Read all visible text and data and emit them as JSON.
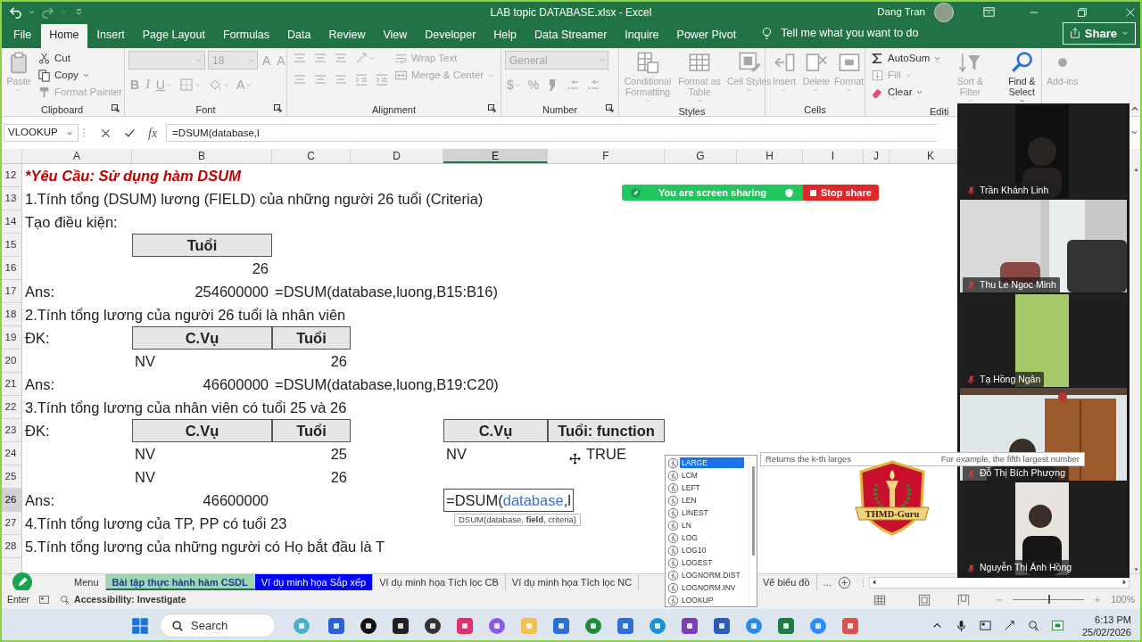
{
  "window": {
    "title": "LAB topic DATABASE.xlsx  -  Excel",
    "user": "Dang Tran"
  },
  "ribbon_tabs": [
    {
      "label": "File",
      "selected": false
    },
    {
      "label": "Home",
      "selected": true
    },
    {
      "label": "Insert",
      "selected": false
    },
    {
      "label": "Page Layout",
      "selected": false
    },
    {
      "label": "Formulas",
      "selected": false
    },
    {
      "label": "Data",
      "selected": false
    },
    {
      "label": "Review",
      "selected": false
    },
    {
      "label": "View",
      "selected": false
    },
    {
      "label": "Developer",
      "selected": false
    },
    {
      "label": "Help",
      "selected": false
    },
    {
      "label": "Data Streamer",
      "selected": false
    },
    {
      "label": "Inquire",
      "selected": false
    },
    {
      "label": "Power Pivot",
      "selected": false
    }
  ],
  "tell_me": {
    "placeholder": "Tell me what you want to do"
  },
  "share_button": "Share",
  "ribbon_groups": [
    {
      "label": "Clipboard",
      "items": [
        {
          "kind": "large",
          "label": "Paste",
          "disabled": true,
          "dropdown": true
        },
        {
          "kind": "stack",
          "buttons": [
            {
              "kind": "text",
              "label": "Cut",
              "disabled": false,
              "dropdown": false
            },
            {
              "kind": "text",
              "label": "Copy",
              "disabled": false,
              "dropdown": true
            },
            {
              "kind": "text",
              "label": "Format Painter",
              "disabled": true,
              "dropdown": false
            }
          ]
        },
        {
          "kind": "launcher"
        }
      ]
    },
    {
      "label": "Font",
      "items": [
        {
          "kind": "rows",
          "rows": [
            [
              {
                "kind": "combo",
                "disabled": true
              },
              {
                "kind": "combo",
                "value": "18",
                "disabled": true
              },
              {
                "kind": "glyph",
                "label": "A",
                "disabled": true,
                "dropdown": false
              },
              {
                "kind": "glyph",
                "label": "A",
                "disabled": true,
                "dropdown": false
              }
            ],
            [
              {
                "kind": "glyph",
                "label": "B",
                "disabled": true,
                "dropdown": false
              },
              {
                "kind": "glyph",
                "label": "I",
                "disabled": true,
                "dropdown": false
              },
              {
                "kind": "glyph",
                "label": "U",
                "disabled": true,
                "dropdown": true
              },
              {
                "kind": "icon",
                "disabled": true,
                "dropdown": true
              },
              {
                "kind": "icon",
                "disabled": true,
                "dropdown": true
              },
              {
                "kind": "glyph",
                "label": "A",
                "disabled": true,
                "dropdown": true
              }
            ]
          ]
        },
        {
          "kind": "launcher"
        }
      ]
    },
    {
      "label": "Alignment",
      "items": [
        {
          "kind": "rows",
          "rows": [
            [
              {
                "kind": "icon",
                "disabled": true,
                "dropdown": false
              },
              {
                "kind": "icon",
                "disabled": true,
                "dropdown": false
              },
              {
                "kind": "icon",
                "disabled": true,
                "dropdown": false
              },
              {
                "kind": "icon",
                "disabled": true,
                "dropdown": true
              }
            ],
            [
              {
                "kind": "icon",
                "disabled": true,
                "dropdown": false
              },
              {
                "kind": "icon",
                "disabled": true,
                "dropdown": false
              },
              {
                "kind": "icon",
                "disabled": true,
                "dropdown": false
              },
              {
                "kind": "icon",
                "disabled": true,
                "dropdown": false
              },
              {
                "kind": "icon",
                "disabled": true,
                "dropdown": false
              }
            ]
          ]
        },
        {
          "kind": "stack",
          "buttons": [
            {
              "kind": "text",
              "label": "Wrap Text",
              "disabled": true,
              "dropdown": false
            },
            {
              "kind": "text",
              "label": "Merge & Center",
              "disabled": true,
              "dropdown": true
            }
          ]
        },
        {
          "kind": "launcher"
        }
      ]
    },
    {
      "label": "Number",
      "items": [
        {
          "kind": "rows",
          "rows": [
            [
              {
                "kind": "combo",
                "value": "General",
                "disabled": true
              }
            ],
            [
              {
                "kind": "glyph",
                "label": "$",
                "disabled": true,
                "dropdown": true
              },
              {
                "kind": "glyph",
                "label": "%",
                "disabled": true,
                "dropdown": false
              },
              {
                "kind": "icon",
                "disabled": true,
                "dropdown": false
              },
              {
                "kind": "icon",
                "disabled": true,
                "dropdown": false
              },
              {
                "kind": "icon",
                "disabled": true,
                "dropdown": false
              }
            ]
          ]
        },
        {
          "kind": "launcher"
        }
      ]
    },
    {
      "label": "Styles",
      "items": [
        {
          "kind": "large",
          "label": "Conditional Formatting",
          "disabled": true,
          "dropdown": true
        },
        {
          "kind": "large",
          "label": "Format as Table",
          "disabled": true,
          "dropdown": true
        },
        {
          "kind": "large",
          "label": "Cell Styles",
          "disabled": true,
          "dropdown": true
        }
      ]
    },
    {
      "label": "Cells",
      "items": [
        {
          "kind": "large",
          "label": "Insert",
          "disabled": true,
          "dropdown": true
        },
        {
          "kind": "large",
          "label": "Delete",
          "disabled": true,
          "dropdown": true
        },
        {
          "kind": "large",
          "label": "Format",
          "disabled": true,
          "dropdown": true
        }
      ]
    },
    {
      "label": "Editi",
      "items": [
        {
          "kind": "stack",
          "buttons": [
            {
              "kind": "text",
              "label": "AutoSum",
              "disabled": false,
              "dropdown": true
            },
            {
              "kind": "text",
              "label": "Fill",
              "disabled": true,
              "dropdown": true
            },
            {
              "kind": "text",
              "label": "Clear",
              "disabled": false,
              "dropdown": true
            }
          ]
        },
        {
          "kind": "large",
          "label": "Sort & Filter",
          "disabled": true,
          "dropdown": true
        },
        {
          "kind": "large",
          "label": "Find & Select",
          "disabled": false,
          "dropdown": true
        }
      ]
    },
    {
      "items": [
        {
          "kind": "large",
          "label": "Add-ins",
          "disabled": true,
          "dropdown": false
        }
      ]
    }
  ],
  "formula_bar": {
    "name_box": "VLOOKUP",
    "function_button": "fx",
    "formula": "=DSUM(database,l"
  },
  "columns": [
    {
      "label": "A",
      "selected": false
    },
    {
      "label": "B",
      "selected": false
    },
    {
      "label": "C",
      "selected": false
    },
    {
      "label": "D",
      "selected": false
    },
    {
      "label": "E",
      "selected": true
    },
    {
      "label": "F",
      "selected": false
    },
    {
      "label": "G",
      "selected": false
    },
    {
      "label": "H",
      "selected": false
    },
    {
      "label": "I",
      "selected": false
    },
    {
      "label": "J",
      "selected": false
    },
    {
      "label": "K",
      "selected": false
    }
  ],
  "rows": [
    {
      "number": "12",
      "selected": false,
      "cells": [
        {
          "kind": "title",
          "text": "*Yêu Cầu: Sử dụng hàm DSUM"
        }
      ]
    },
    {
      "number": "13",
      "selected": false,
      "cells": [
        {
          "kind": "text",
          "text": "1.Tính tổng (DSUM) lương (FIELD) của những người 26 tuổi (Criteria)"
        }
      ]
    },
    {
      "number": "14",
      "selected": false,
      "cells": [
        {
          "kind": "text",
          "text": "Tạo điều kiện:"
        }
      ]
    },
    {
      "number": "15",
      "selected": false,
      "cells": [
        {},
        {
          "kind": "header",
          "text": "Tuổi"
        }
      ]
    },
    {
      "number": "16",
      "selected": false,
      "cells": [
        {},
        {
          "kind": "number",
          "text": "26"
        }
      ]
    },
    {
      "number": "17",
      "selected": false,
      "cells": [
        {
          "kind": "text",
          "text": "Ans:"
        },
        {
          "kind": "number",
          "text": "254600000"
        },
        {
          "kind": "text",
          "text": "=DSUM(database,luong,B15:B16)"
        }
      ]
    },
    {
      "number": "18",
      "selected": false,
      "cells": [
        {
          "kind": "text",
          "text": "2.Tính tổng lương của người 26 tuổi là nhân viên"
        }
      ]
    },
    {
      "number": "19",
      "selected": false,
      "cells": [
        {
          "kind": "text",
          "text": "ĐK:"
        },
        {
          "kind": "header",
          "text": "C.Vụ"
        },
        {
          "kind": "header",
          "text": "Tuổi"
        }
      ]
    },
    {
      "number": "20",
      "selected": false,
      "cells": [
        {},
        {
          "kind": "text",
          "text": "NV"
        },
        {
          "kind": "number",
          "text": "26"
        }
      ]
    },
    {
      "number": "21",
      "selected": false,
      "cells": [
        {
          "kind": "text",
          "text": "Ans:"
        },
        {
          "kind": "number",
          "text": "46600000"
        },
        {
          "kind": "text",
          "text": "=DSUM(database,luong,B19:C20)"
        }
      ]
    },
    {
      "number": "22",
      "selected": false,
      "cells": [
        {
          "kind": "text",
          "text": "3.Tính tổng lương của nhân viên có tuổi 25 và 26"
        }
      ]
    },
    {
      "number": "23",
      "selected": false,
      "cells": [
        {
          "kind": "text",
          "text": "ĐK:"
        },
        {
          "kind": "header",
          "text": "C.Vụ"
        },
        {
          "kind": "header",
          "text": "Tuổi"
        },
        {},
        {
          "kind": "header",
          "text": "C.Vụ"
        },
        {
          "kind": "header",
          "text": "Tuổi: function"
        }
      ]
    },
    {
      "number": "24",
      "selected": false,
      "cells": [
        {},
        {
          "kind": "text",
          "text": "NV"
        },
        {
          "kind": "number",
          "text": "25"
        },
        {},
        {
          "kind": "text",
          "text": "NV"
        },
        {
          "kind": "boolean",
          "text": "TRUE"
        }
      ]
    },
    {
      "number": "25",
      "selected": false,
      "cells": [
        {},
        {
          "kind": "text",
          "text": "NV"
        },
        {
          "kind": "number",
          "text": "26"
        }
      ]
    },
    {
      "number": "26",
      "selected": true,
      "cells": [
        {
          "kind": "text",
          "text": "Ans:"
        },
        {
          "kind": "number",
          "text": "46600000"
        },
        {},
        {},
        {
          "kind": "editing",
          "segments": [
            {
              "kind": "plain",
              "text": "=DSUM("
            },
            {
              "kind": "reference",
              "text": "database"
            },
            {
              "kind": "plain",
              "text": ",l"
            }
          ],
          "hint": "DSUM(database, **field**, criteria)"
        }
      ]
    },
    {
      "number": "27",
      "selected": false,
      "cells": [
        {
          "kind": "text",
          "text": "4.Tính tổng lương của TP, PP có tuổi 23"
        }
      ]
    },
    {
      "number": "28",
      "selected": false,
      "cells": [
        {
          "kind": "text",
          "text": "5.Tính tổng lương của những người có Họ bắt đầu là T"
        }
      ]
    }
  ],
  "screen_share": {
    "status": "You are screen sharing",
    "stop": "Stop share"
  },
  "autocomplete": [
    {
      "label": "LARGE",
      "selected": true
    },
    {
      "label": "LCM",
      "selected": false
    },
    {
      "label": "LEFT",
      "selected": false
    },
    {
      "label": "LEN",
      "selected": false
    },
    {
      "label": "LINEST",
      "selected": false
    },
    {
      "label": "LN",
      "selected": false
    },
    {
      "label": "LOG",
      "selected": false
    },
    {
      "label": "LOG10",
      "selected": false
    },
    {
      "label": "LOGEST",
      "selected": false
    },
    {
      "label": "LOGNORM.DIST",
      "selected": false
    },
    {
      "label": "LOGNORM.INV",
      "selected": false
    },
    {
      "label": "LOOKUP",
      "selected": false
    }
  ],
  "function_tip": {
    "start": "Returns the k-th larges",
    "end": "For example, the fifth largest number"
  },
  "logo": {
    "text": "THMD-Guru"
  },
  "participants": [
    {
      "name": "Trần Khánh Linh",
      "muted": true
    },
    {
      "name": "Thu Le Ngoc Minh",
      "muted": true
    },
    {
      "name": "Tạ Hồng Ngân",
      "muted": true
    },
    {
      "name": "Đỗ Thị Bích Phượng",
      "muted": true
    },
    {
      "name": "Nguyễn Thị Ánh Hồng",
      "muted": true
    }
  ],
  "sheet_tabs": [
    {
      "label": "Menu",
      "selected": false
    },
    {
      "label": "Bài tập thực hành hàm CSDL",
      "selected": true,
      "color": "#9fd4b4"
    },
    {
      "label": "Ví dụ minh họa Sắp xếp",
      "selected": false,
      "color": "#0000ff"
    },
    {
      "label": "Ví dụ minh họa Tích lọc CB",
      "selected": false
    },
    {
      "label": "Ví dụ minh họa Tích lọc NC",
      "selected": false
    },
    {
      "label": "Vẽ biểu đồ",
      "selected": false
    }
  ],
  "more_tabs": "...",
  "status_bar": {
    "mode": "Enter",
    "accessibility": "Accessibility: Investigate",
    "zoom": "100%"
  },
  "zoom_slider": {
    "level": 0.5
  },
  "taskbar": {
    "search": {
      "placeholder": "Search"
    },
    "time": "6:13 PM",
    "date": "25/02/2026"
  }
}
